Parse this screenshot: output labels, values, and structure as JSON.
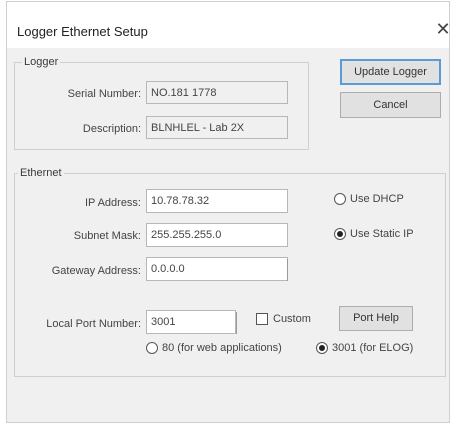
{
  "window": {
    "title": "Logger Ethernet Setup",
    "close_glyph": "✕"
  },
  "logger_group": {
    "legend": "Logger",
    "serial_label": "Serial Number:",
    "serial_value": "NO.181 1778",
    "description_label": "Description:",
    "description_value": "BLNHLEL - Lab 2X"
  },
  "buttons": {
    "update_logger": "Update Logger",
    "cancel": "Cancel",
    "port_help": "Port Help"
  },
  "ethernet_group": {
    "legend": "Ethernet",
    "ip_label": "IP Address:",
    "ip_value": "10.78.78.32",
    "subnet_label": "Subnet Mask:",
    "subnet_value": "255.255.255.0",
    "gateway_label": "Gateway Address:",
    "gateway_value": "0.0.0.0",
    "use_dhcp": "Use DHCP",
    "use_static_ip": "Use Static IP",
    "static_selected": true,
    "port_label": "Local Port Number:",
    "port_value": "3001",
    "custom_label": "Custom",
    "custom_checked": false,
    "port_option_80": "80 (for web applications)",
    "port_option_3001": "3001 (for ELOG)",
    "port_3001_selected": true
  },
  "icons": {
    "close": "close-icon",
    "radio": "radio-icon",
    "checkbox": "checkbox-icon"
  }
}
